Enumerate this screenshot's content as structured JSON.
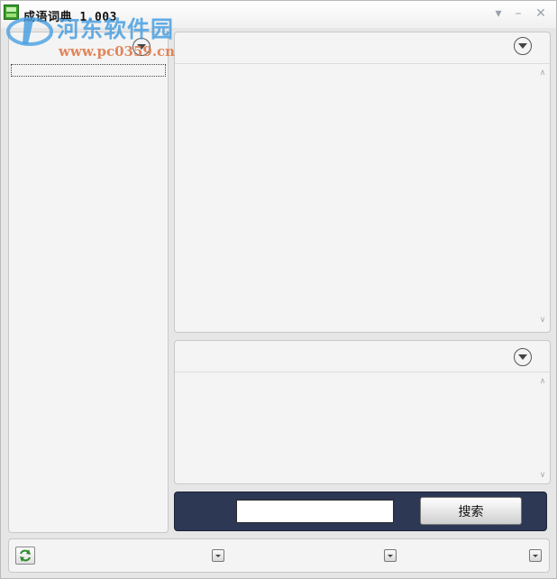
{
  "window": {
    "title": "成语词典 1.003",
    "controls": {
      "dropdown": "▾",
      "minimize": "–",
      "close": "✕"
    }
  },
  "watermark": {
    "name": "河东软件园",
    "url": "www.pc0359.cn"
  },
  "search": {
    "input_value": "",
    "button_label": "搜索"
  },
  "icons": {
    "app": "dictionary-app-icon",
    "refresh": "refresh-icon",
    "expand": "chevron-down-circle-icon"
  },
  "colors": {
    "search_bar_bg": "#2c3854",
    "panel_bg": "#f4f4f4",
    "window_bg": "#e6e6e6"
  }
}
